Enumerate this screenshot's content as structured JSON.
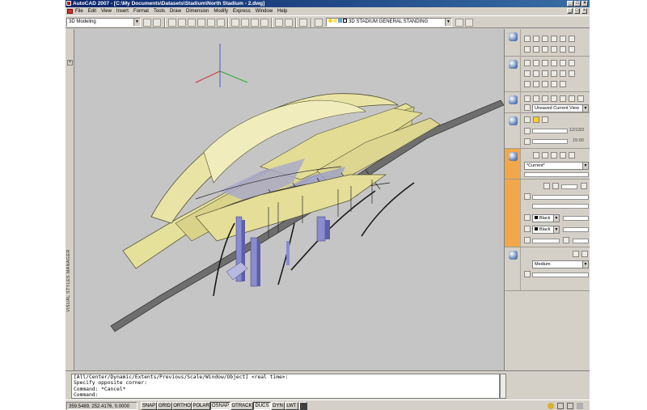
{
  "window": {
    "title": "AutoCAD 2007 - [C:\\My Documents\\Datasets\\Stadium\\North Stadium - 2.dwg]"
  },
  "menu": [
    "File",
    "Edit",
    "View",
    "Insert",
    "Format",
    "Tools",
    "Draw",
    "Dimension",
    "Modify",
    "Express",
    "Window",
    "Help"
  ],
  "toolbar": {
    "workspace": "3D Modeling",
    "layer": "3D STADIUM GENERAL STANDING"
  },
  "palette_tab": {
    "label": "VISUAL STYLES MANAGER"
  },
  "dashboard": {
    "view_combo": "Unsaved Current View",
    "time_value_1": "12/13/2",
    "time_value_2": "15:00",
    "material_combo": "*Current*",
    "color_1": "Black",
    "color_2": "Black",
    "render_preset": "Medium"
  },
  "command": {
    "lines": [
      "[All/Center/Dynamic/Extents/Previous/Scale/Window/Object] <real time>:",
      "Specify opposite corner:",
      "Command: *Cancel*",
      "Command:"
    ]
  },
  "status": {
    "coords": "359.5489, 252.4176, 0.0000",
    "toggles": [
      {
        "label": "SNAP",
        "on": false
      },
      {
        "label": "GRID",
        "on": false
      },
      {
        "label": "ORTHO",
        "on": false
      },
      {
        "label": "POLAR",
        "on": false
      },
      {
        "label": "OSNAP",
        "on": true
      },
      {
        "label": "OTRACK",
        "on": false
      },
      {
        "label": "DUCS",
        "on": true
      },
      {
        "label": "DYN",
        "on": false
      },
      {
        "label": "LWT",
        "on": false
      }
    ]
  },
  "colors": {
    "title_bar": "#0a246a",
    "viewport_bg": "#c5c5c5",
    "roof_fill": "#e6e19a",
    "column_fill": "#8a8cd0",
    "road_fill": "#707070",
    "dashboard_accent": "#f0a84a"
  }
}
